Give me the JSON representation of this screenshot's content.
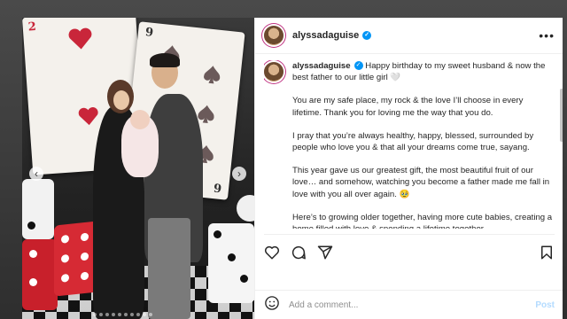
{
  "post": {
    "username": "alyssadaguise",
    "verified_icon": "verified-badge-icon",
    "more_icon": "more-options-icon",
    "caption": [
      "Happy birthday to my sweet husband & now the best father to our little girl 🤍",
      "You are my safe place, my rock & the love I’ll choose in every lifetime. Thank you for loving me the way that you do.",
      "I pray that you’re always healthy, happy, blessed, surrounded by people who love you & that all your dreams come true, sayang.",
      "This year gave us our greatest gift, the most beautiful fruit of our love… and somehow, watching you become a father made me fall in love with you all over again. 🥹",
      "Here’s to growing older together, having more cute babies, creating a home filled with love & spending a lifetime together"
    ]
  },
  "photo": {
    "prev_icon": "chevron-left-icon",
    "next_icon": "chevron-right-icon",
    "prev_glyph": "‹",
    "next_glyph": "›",
    "card_ranks": [
      "2",
      "9",
      "6"
    ]
  },
  "actions": {
    "like_icon": "heart-icon",
    "comment_icon": "comment-icon",
    "share_icon": "share-icon",
    "save_icon": "bookmark-icon"
  },
  "comment_box": {
    "emoji_icon": "emoji-icon",
    "placeholder": "Add a comment...",
    "post_label": "Post"
  },
  "colors": {
    "verified": "#0095f6",
    "post_button": "#b3dbff",
    "text": "#262626"
  }
}
